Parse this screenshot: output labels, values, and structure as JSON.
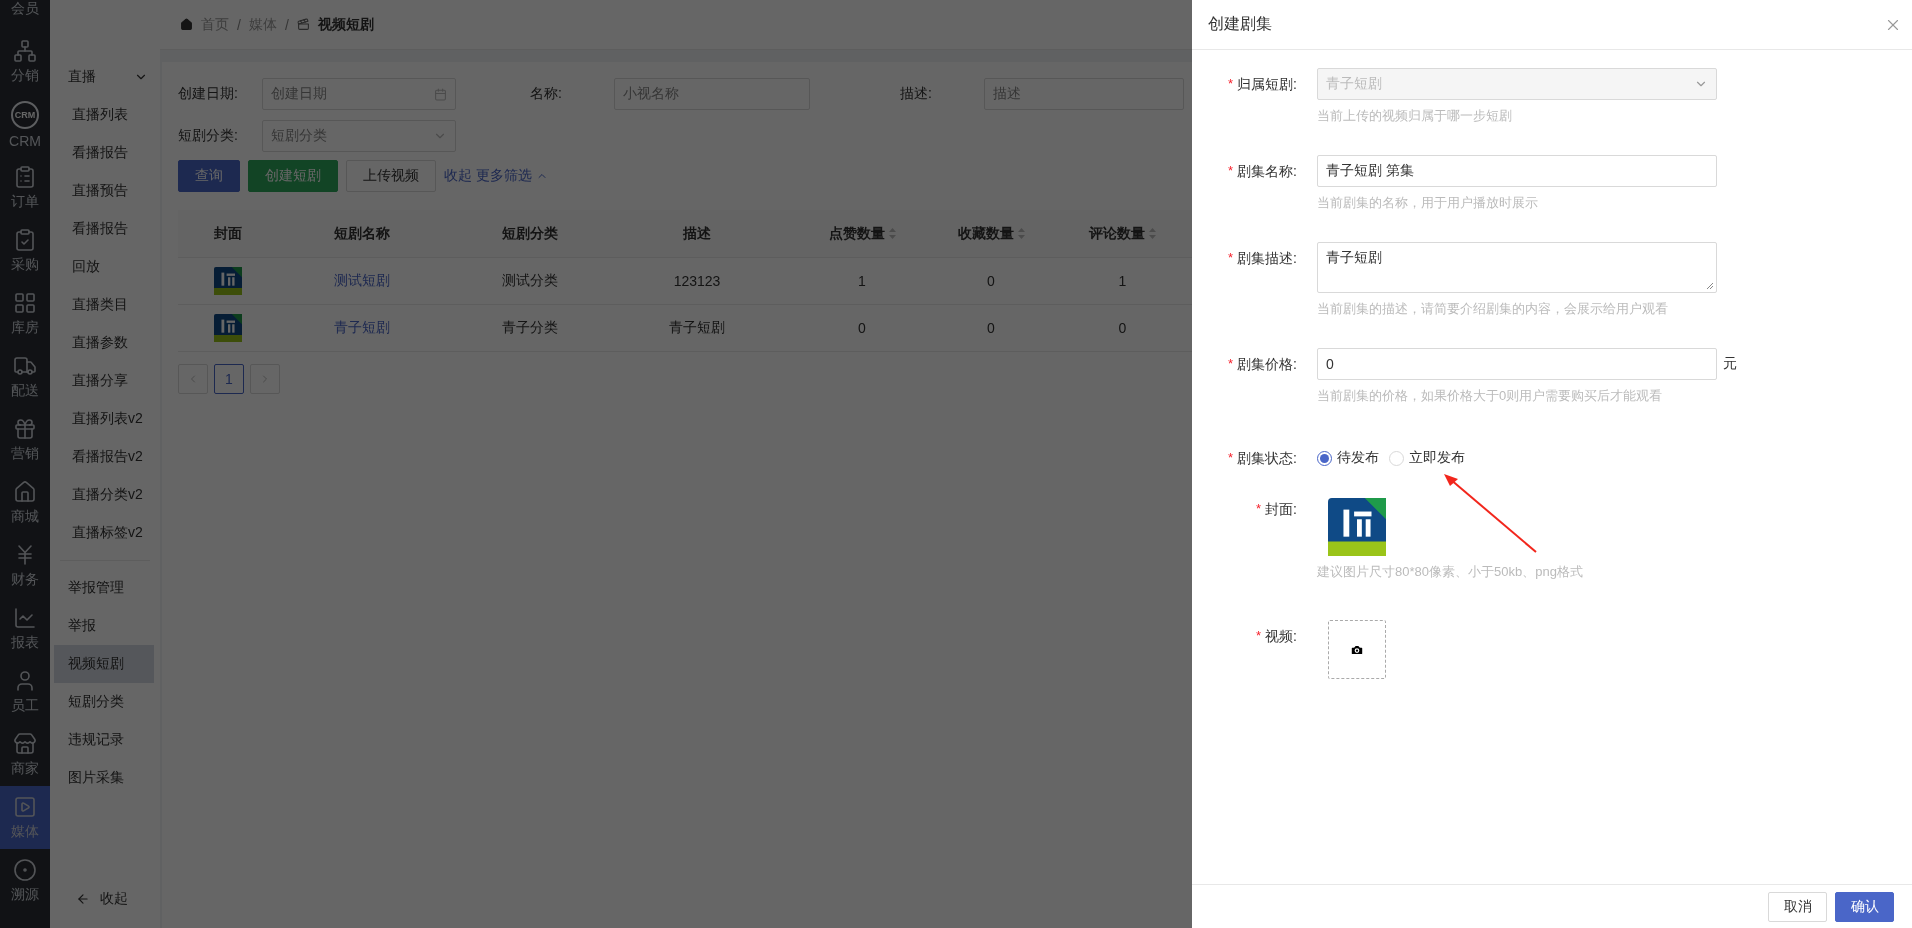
{
  "sidebar": {
    "items": [
      {
        "label": "会员",
        "selected": false
      },
      {
        "label": "分销",
        "selected": false
      },
      {
        "label": "CRM",
        "icon_text": "CRM",
        "selected": false
      },
      {
        "label": "订单",
        "selected": false
      },
      {
        "label": "采购",
        "selected": false
      },
      {
        "label": "库房",
        "selected": false
      },
      {
        "label": "配送",
        "selected": false
      },
      {
        "label": "营销",
        "selected": false
      },
      {
        "label": "商城",
        "selected": false
      },
      {
        "label": "财务",
        "selected": false
      },
      {
        "label": "报表",
        "selected": false
      },
      {
        "label": "员工",
        "selected": false
      },
      {
        "label": "商家",
        "selected": false
      },
      {
        "label": "媒体",
        "selected": true
      },
      {
        "label": "溯源",
        "selected": false
      }
    ]
  },
  "submenu": {
    "group": {
      "label": "直播",
      "expanded": true,
      "items": [
        {
          "label": "直播列表",
          "selected": false
        },
        {
          "label": "看播报告",
          "selected": false
        },
        {
          "label": "直播预告",
          "selected": false
        },
        {
          "label": "看播报告",
          "selected": false
        },
        {
          "label": "回放",
          "selected": false
        },
        {
          "label": "直播类目",
          "selected": false
        },
        {
          "label": "直播参数",
          "selected": false
        },
        {
          "label": "直播分享",
          "selected": false
        },
        {
          "label": "直播列表v2",
          "selected": false
        },
        {
          "label": "看播报告v2",
          "selected": false
        },
        {
          "label": "直播分类v2",
          "selected": false
        },
        {
          "label": "直播标签v2",
          "selected": false
        }
      ]
    },
    "items": [
      {
        "label": "举报管理",
        "selected": false
      },
      {
        "label": "举报",
        "selected": false
      },
      {
        "label": "视频短剧",
        "selected": true
      },
      {
        "label": "短剧分类",
        "selected": false
      },
      {
        "label": "违规记录",
        "selected": false
      },
      {
        "label": "图片采集",
        "selected": false
      }
    ],
    "collapse": "收起"
  },
  "breadcrumb": {
    "items": [
      "首页",
      "媒体",
      "视频短剧"
    ],
    "separator": "/"
  },
  "filters": [
    {
      "label": "创建日期:",
      "placeholder": "创建日期",
      "kind": "date"
    },
    {
      "label": "名称:",
      "placeholder": "小视名称",
      "kind": "text"
    },
    {
      "label": "描述:",
      "placeholder": "描述",
      "kind": "text"
    },
    {
      "label": "短剧分类:",
      "placeholder": "短剧分类",
      "kind": "select"
    }
  ],
  "actions": [
    {
      "label": "查询",
      "kind": "primary"
    },
    {
      "label": "创建短剧",
      "kind": "success"
    },
    {
      "label": "上传视频",
      "kind": "default"
    }
  ],
  "filter_toggle": "收起 更多筛选",
  "table": {
    "columns": [
      {
        "label": "封面",
        "sortable": false
      },
      {
        "label": "短剧名称",
        "sortable": false
      },
      {
        "label": "短剧分类",
        "sortable": false
      },
      {
        "label": "描述",
        "sortable": false
      },
      {
        "label": "点赞数量",
        "sortable": true
      },
      {
        "label": "收藏数量",
        "sortable": true
      },
      {
        "label": "评论数量",
        "sortable": true
      }
    ],
    "rows": [
      {
        "name": "测试短剧",
        "category": "测试分类",
        "description": "123123",
        "likes": "1",
        "favorites": "0",
        "comments": "1"
      },
      {
        "name": "青子短剧",
        "category": "青子分类",
        "description": "青子短剧",
        "likes": "0",
        "favorites": "0",
        "comments": "0"
      }
    ]
  },
  "pagination": {
    "pages": [
      {
        "label": "1",
        "selected": true
      }
    ]
  },
  "drawer": {
    "title": "创建剧集",
    "fields": [
      {
        "kind": "select",
        "label": "归属短剧:",
        "required_mark": "*",
        "value": "青子短剧",
        "disabled": true,
        "help": "当前上传的视频归属于哪一步短剧"
      },
      {
        "kind": "text",
        "label": "剧集名称:",
        "required_mark": "*",
        "value": "青子短剧 第集",
        "help": "当前剧集的名称，用于用户播放时展示"
      },
      {
        "kind": "textarea",
        "label": "剧集描述:",
        "required_mark": "*",
        "value": "青子短剧",
        "help": "当前剧集的描述，请简要介绍剧集的内容，会展示给用户观看"
      },
      {
        "kind": "text",
        "label": "剧集价格:",
        "required_mark": "*",
        "value": "0",
        "suffix": "元",
        "help": "当前剧集的价格，如果价格大于0则用户需要购买后才能观看"
      },
      {
        "kind": "radio",
        "label": "剧集状态:",
        "required_mark": "*",
        "options": [
          {
            "label": "待发布",
            "selected": true
          },
          {
            "label": "立即发布",
            "selected": false
          }
        ]
      },
      {
        "label": "封面:",
        "required_mark": "*",
        "help": "建议图片尺寸80*80像素、小于50kb、png格式"
      },
      {
        "kind": "upload",
        "label": "视频:",
        "required_mark": "*"
      }
    ],
    "buttons": [
      {
        "label": "取消",
        "kind": "default"
      },
      {
        "label": "确认",
        "kind": "primary"
      }
    ]
  }
}
